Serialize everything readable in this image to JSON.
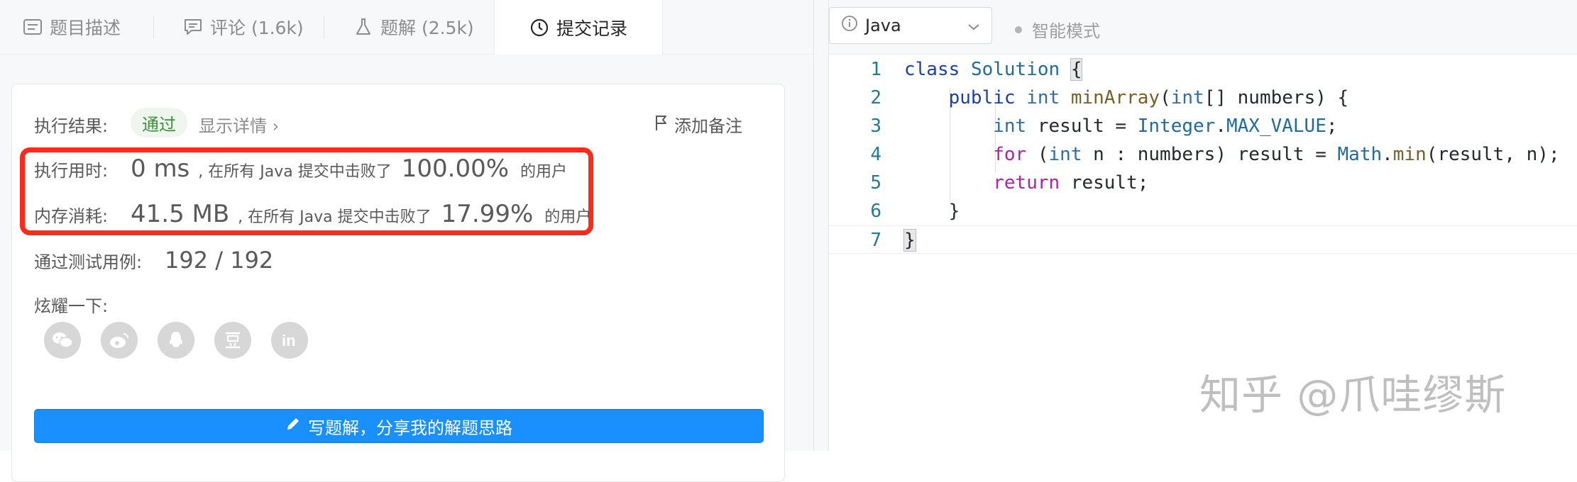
{
  "tabs": [
    {
      "label": "题目描述",
      "icon": "document-icon"
    },
    {
      "label": "评论 (1.6k)",
      "icon": "comment-icon"
    },
    {
      "label": "题解 (2.5k)",
      "icon": "flask-icon"
    },
    {
      "label": "提交记录",
      "icon": "clock-icon"
    }
  ],
  "result": {
    "label": "执行结果:",
    "status": "通过",
    "details": "显示详情 ›",
    "note": "添加备注"
  },
  "stats": {
    "time_label": "执行用时:",
    "time_value": "0 ms",
    "time_text": ", 在所有 Java 提交中击败了",
    "time_percent": "100.00%",
    "time_tail": "的用户",
    "memory_label": "内存消耗:",
    "memory_value": "41.5 MB",
    "memory_text": ", 在所有 Java 提交中击败了",
    "memory_percent": "17.99%",
    "memory_tail": "的用户"
  },
  "tests": {
    "label": "通过测试用例:",
    "value": "192  /  192"
  },
  "share": {
    "label": "炫耀一下:",
    "icons": [
      "wechat-icon",
      "weibo-icon",
      "qq-icon",
      "douban-icon",
      "linkedin-icon"
    ]
  },
  "write_button": "写题解，分享我的解题思路",
  "editor": {
    "language": "Java",
    "mode": "智能模式",
    "line_numbers": [
      "1",
      "2",
      "3",
      "4",
      "5",
      "6",
      "7"
    ]
  },
  "watermark": "知乎 @爪哇缪斯",
  "colors": {
    "accent": "#1a90ff",
    "highlight": "#ff2a1a",
    "success": "#3f8f3c"
  }
}
